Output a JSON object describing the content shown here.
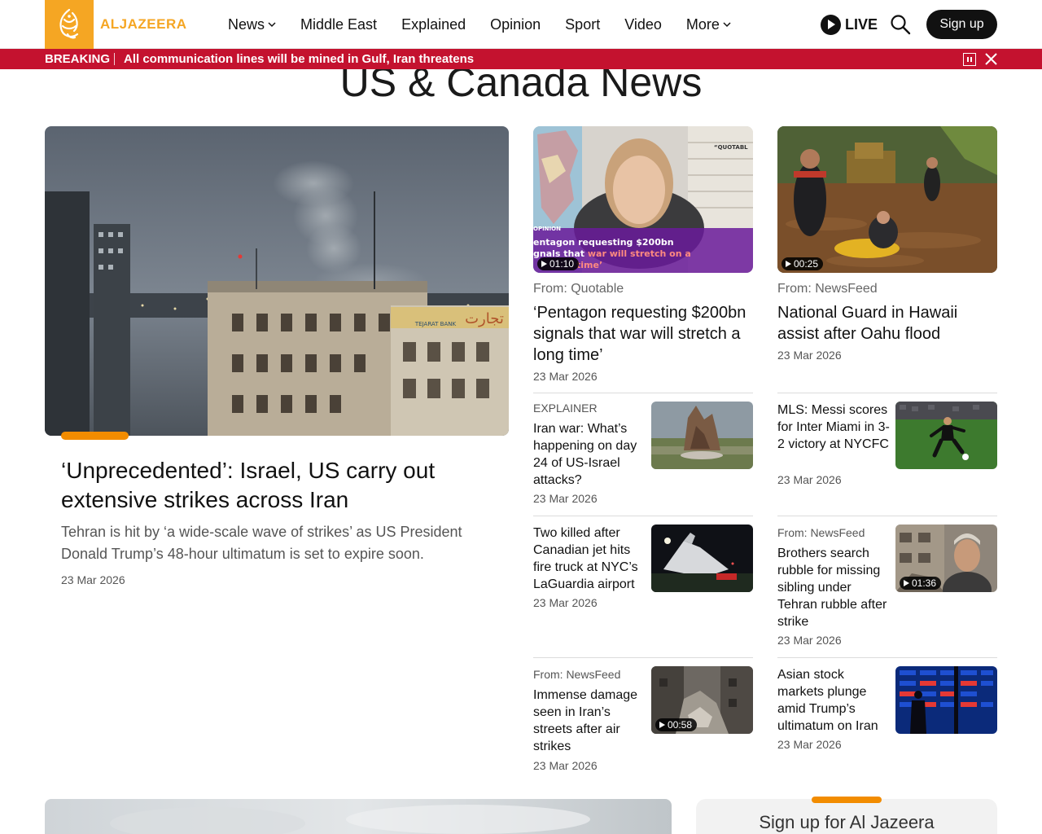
{
  "header": {
    "logo_text": "ALJAZEERA",
    "nav": [
      {
        "label": "News",
        "dropdown": true
      },
      {
        "label": "Middle East",
        "dropdown": false
      },
      {
        "label": "Explained",
        "dropdown": false
      },
      {
        "label": "Opinion",
        "dropdown": false
      },
      {
        "label": "Sport",
        "dropdown": false
      },
      {
        "label": "Video",
        "dropdown": false
      },
      {
        "label": "More",
        "dropdown": true
      }
    ],
    "live_label": "LIVE",
    "signup_label": "Sign up",
    "icons": {
      "live": "play-icon",
      "search": "search-icon",
      "dropdown": "chevron-down-icon"
    }
  },
  "breaking": {
    "label": "BREAKING",
    "text": "All communication lines will be mined in Gulf, Iran threatens",
    "icons": {
      "pause": "pause-icon",
      "close": "close-icon"
    }
  },
  "page": {
    "title": "US & Canada News"
  },
  "featured": {
    "title": "‘Unprecedented’: Israel, US carry out extensive strikes across Iran",
    "summary": "Tehran is hit by ‘a wide-scale wave of strikes’ as US President Donald Trump’s 48-hour ultimatum is set to expire soon.",
    "date": "23 Mar 2026"
  },
  "cards": [
    {
      "from": "From: Quotable",
      "title": "‘Pentagon requesting $200bn signals that war will stretch a long time’",
      "date": "23 Mar 2026",
      "duration": "01:10",
      "overlay": {
        "tag": "OPINION",
        "quote_label": "“QUOTABL",
        "line1": "entagon requesting $200bn",
        "line2a": "gnals that ",
        "line2b": "war will stretch on a",
        "line3": "time’"
      }
    },
    {
      "from": "From: NewsFeed",
      "title": "National Guard in Hawaii assist after Oahu flood",
      "date": "23 Mar 2026",
      "duration": "00:25"
    }
  ],
  "small_left": [
    {
      "kicker": "EXPLAINER",
      "title": "Iran war: What’s happening on day 24 of US-Israel attacks?",
      "date": "23 Mar 2026"
    },
    {
      "kicker": "",
      "title": "Two killed after Canadian jet hits fire truck at NYC’s LaGuardia airport",
      "date": "23 Mar 2026"
    },
    {
      "kicker": "From: NewsFeed",
      "title": "Immense damage seen in Iran’s streets after air strikes",
      "date": "23 Mar 2026",
      "duration": "00:58"
    }
  ],
  "small_right": [
    {
      "kicker": "",
      "title": "MLS: Messi scores for Inter Miami in 3-2 victory at NYCFC",
      "date": "23 Mar 2026"
    },
    {
      "kicker": "From: NewsFeed",
      "title": "Brothers search rubble for missing sibling under Tehran rubble after strike",
      "date": "23 Mar 2026",
      "duration": "01:36"
    },
    {
      "kicker": "",
      "title": "Asian stock markets plunge amid Trump’s ultimatum on Iran",
      "date": "23 Mar 2026"
    }
  ],
  "hero_signs": {
    "bank": "TEJARAT BANK",
    "arabic": "تجارت"
  },
  "signup_box": {
    "title": "Sign up for Al Jazeera"
  },
  "colors": {
    "brand": "#f5a623",
    "accent_bar": "#f28c00",
    "breaking": "#c4122f",
    "dark": "#111111"
  }
}
